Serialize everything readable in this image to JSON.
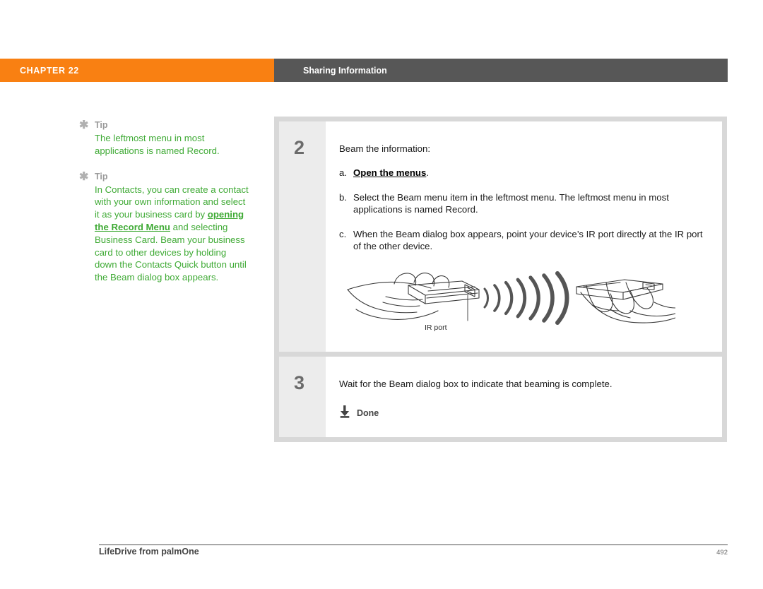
{
  "header": {
    "chapter": "CHAPTER 22",
    "section": "Sharing Information",
    "chapter_color": "#f98012",
    "section_color": "#575757"
  },
  "sidebar": {
    "tips": [
      {
        "icon": "asterisk-icon",
        "label": "Tip",
        "text_before": "The leftmost menu in most applications is named Record.",
        "link": "",
        "text_after": ""
      },
      {
        "icon": "asterisk-icon",
        "label": "Tip",
        "text_before": "In Contacts, you can create a contact with your own information and select it as your business card by ",
        "link": "opening the Record Menu",
        "text_after": " and selecting Business Card. Beam your business card to other devices by holding down the Contacts Quick button until the Beam dialog box appears."
      }
    ],
    "tip_text_color": "#3faa35",
    "tip_label_color": "#9a9a9a"
  },
  "steps": [
    {
      "number": "2",
      "intro": "Beam the information:",
      "substeps": [
        {
          "marker": "a.",
          "text_before": "",
          "link": "Open the menus",
          "text_after": "."
        },
        {
          "marker": "b.",
          "text_before": "Select the Beam menu item in the leftmost menu. The leftmost menu in most applications is named Record.",
          "link": "",
          "text_after": ""
        },
        {
          "marker": "c.",
          "text_before": "When the Beam dialog box appears, point your device’s IR port directly at the IR port of the other device.",
          "link": "",
          "text_after": ""
        }
      ],
      "illustration": {
        "name": "ir-beam-illustration",
        "callout": "IR port"
      }
    },
    {
      "number": "3",
      "intro": "Wait for the Beam dialog box to indicate that beaming is complete.",
      "done": {
        "icon": "download-arrow-icon",
        "label": "Done"
      }
    }
  ],
  "footer": {
    "title": "LifeDrive from palmOne",
    "page": "492"
  }
}
